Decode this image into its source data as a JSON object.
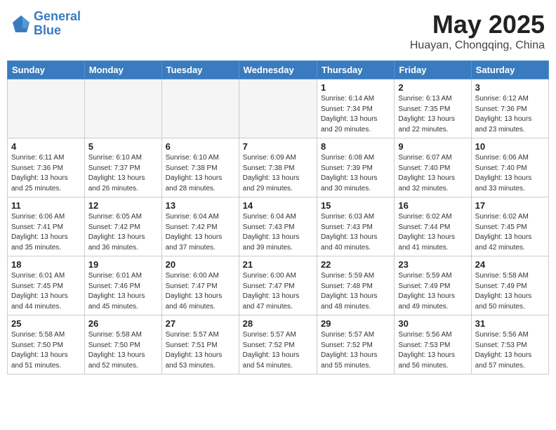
{
  "header": {
    "logo_line1": "General",
    "logo_line2": "Blue",
    "month_year": "May 2025",
    "location": "Huayan, Chongqing, China"
  },
  "weekdays": [
    "Sunday",
    "Monday",
    "Tuesday",
    "Wednesday",
    "Thursday",
    "Friday",
    "Saturday"
  ],
  "weeks": [
    [
      {
        "day": "",
        "info": ""
      },
      {
        "day": "",
        "info": ""
      },
      {
        "day": "",
        "info": ""
      },
      {
        "day": "",
        "info": ""
      },
      {
        "day": "1",
        "info": "Sunrise: 6:14 AM\nSunset: 7:34 PM\nDaylight: 13 hours\nand 20 minutes."
      },
      {
        "day": "2",
        "info": "Sunrise: 6:13 AM\nSunset: 7:35 PM\nDaylight: 13 hours\nand 22 minutes."
      },
      {
        "day": "3",
        "info": "Sunrise: 6:12 AM\nSunset: 7:36 PM\nDaylight: 13 hours\nand 23 minutes."
      }
    ],
    [
      {
        "day": "4",
        "info": "Sunrise: 6:11 AM\nSunset: 7:36 PM\nDaylight: 13 hours\nand 25 minutes."
      },
      {
        "day": "5",
        "info": "Sunrise: 6:10 AM\nSunset: 7:37 PM\nDaylight: 13 hours\nand 26 minutes."
      },
      {
        "day": "6",
        "info": "Sunrise: 6:10 AM\nSunset: 7:38 PM\nDaylight: 13 hours\nand 28 minutes."
      },
      {
        "day": "7",
        "info": "Sunrise: 6:09 AM\nSunset: 7:38 PM\nDaylight: 13 hours\nand 29 minutes."
      },
      {
        "day": "8",
        "info": "Sunrise: 6:08 AM\nSunset: 7:39 PM\nDaylight: 13 hours\nand 30 minutes."
      },
      {
        "day": "9",
        "info": "Sunrise: 6:07 AM\nSunset: 7:40 PM\nDaylight: 13 hours\nand 32 minutes."
      },
      {
        "day": "10",
        "info": "Sunrise: 6:06 AM\nSunset: 7:40 PM\nDaylight: 13 hours\nand 33 minutes."
      }
    ],
    [
      {
        "day": "11",
        "info": "Sunrise: 6:06 AM\nSunset: 7:41 PM\nDaylight: 13 hours\nand 35 minutes."
      },
      {
        "day": "12",
        "info": "Sunrise: 6:05 AM\nSunset: 7:42 PM\nDaylight: 13 hours\nand 36 minutes."
      },
      {
        "day": "13",
        "info": "Sunrise: 6:04 AM\nSunset: 7:42 PM\nDaylight: 13 hours\nand 37 minutes."
      },
      {
        "day": "14",
        "info": "Sunrise: 6:04 AM\nSunset: 7:43 PM\nDaylight: 13 hours\nand 39 minutes."
      },
      {
        "day": "15",
        "info": "Sunrise: 6:03 AM\nSunset: 7:43 PM\nDaylight: 13 hours\nand 40 minutes."
      },
      {
        "day": "16",
        "info": "Sunrise: 6:02 AM\nSunset: 7:44 PM\nDaylight: 13 hours\nand 41 minutes."
      },
      {
        "day": "17",
        "info": "Sunrise: 6:02 AM\nSunset: 7:45 PM\nDaylight: 13 hours\nand 42 minutes."
      }
    ],
    [
      {
        "day": "18",
        "info": "Sunrise: 6:01 AM\nSunset: 7:45 PM\nDaylight: 13 hours\nand 44 minutes."
      },
      {
        "day": "19",
        "info": "Sunrise: 6:01 AM\nSunset: 7:46 PM\nDaylight: 13 hours\nand 45 minutes."
      },
      {
        "day": "20",
        "info": "Sunrise: 6:00 AM\nSunset: 7:47 PM\nDaylight: 13 hours\nand 46 minutes."
      },
      {
        "day": "21",
        "info": "Sunrise: 6:00 AM\nSunset: 7:47 PM\nDaylight: 13 hours\nand 47 minutes."
      },
      {
        "day": "22",
        "info": "Sunrise: 5:59 AM\nSunset: 7:48 PM\nDaylight: 13 hours\nand 48 minutes."
      },
      {
        "day": "23",
        "info": "Sunrise: 5:59 AM\nSunset: 7:49 PM\nDaylight: 13 hours\nand 49 minutes."
      },
      {
        "day": "24",
        "info": "Sunrise: 5:58 AM\nSunset: 7:49 PM\nDaylight: 13 hours\nand 50 minutes."
      }
    ],
    [
      {
        "day": "25",
        "info": "Sunrise: 5:58 AM\nSunset: 7:50 PM\nDaylight: 13 hours\nand 51 minutes."
      },
      {
        "day": "26",
        "info": "Sunrise: 5:58 AM\nSunset: 7:50 PM\nDaylight: 13 hours\nand 52 minutes."
      },
      {
        "day": "27",
        "info": "Sunrise: 5:57 AM\nSunset: 7:51 PM\nDaylight: 13 hours\nand 53 minutes."
      },
      {
        "day": "28",
        "info": "Sunrise: 5:57 AM\nSunset: 7:52 PM\nDaylight: 13 hours\nand 54 minutes."
      },
      {
        "day": "29",
        "info": "Sunrise: 5:57 AM\nSunset: 7:52 PM\nDaylight: 13 hours\nand 55 minutes."
      },
      {
        "day": "30",
        "info": "Sunrise: 5:56 AM\nSunset: 7:53 PM\nDaylight: 13 hours\nand 56 minutes."
      },
      {
        "day": "31",
        "info": "Sunrise: 5:56 AM\nSunset: 7:53 PM\nDaylight: 13 hours\nand 57 minutes."
      }
    ]
  ]
}
